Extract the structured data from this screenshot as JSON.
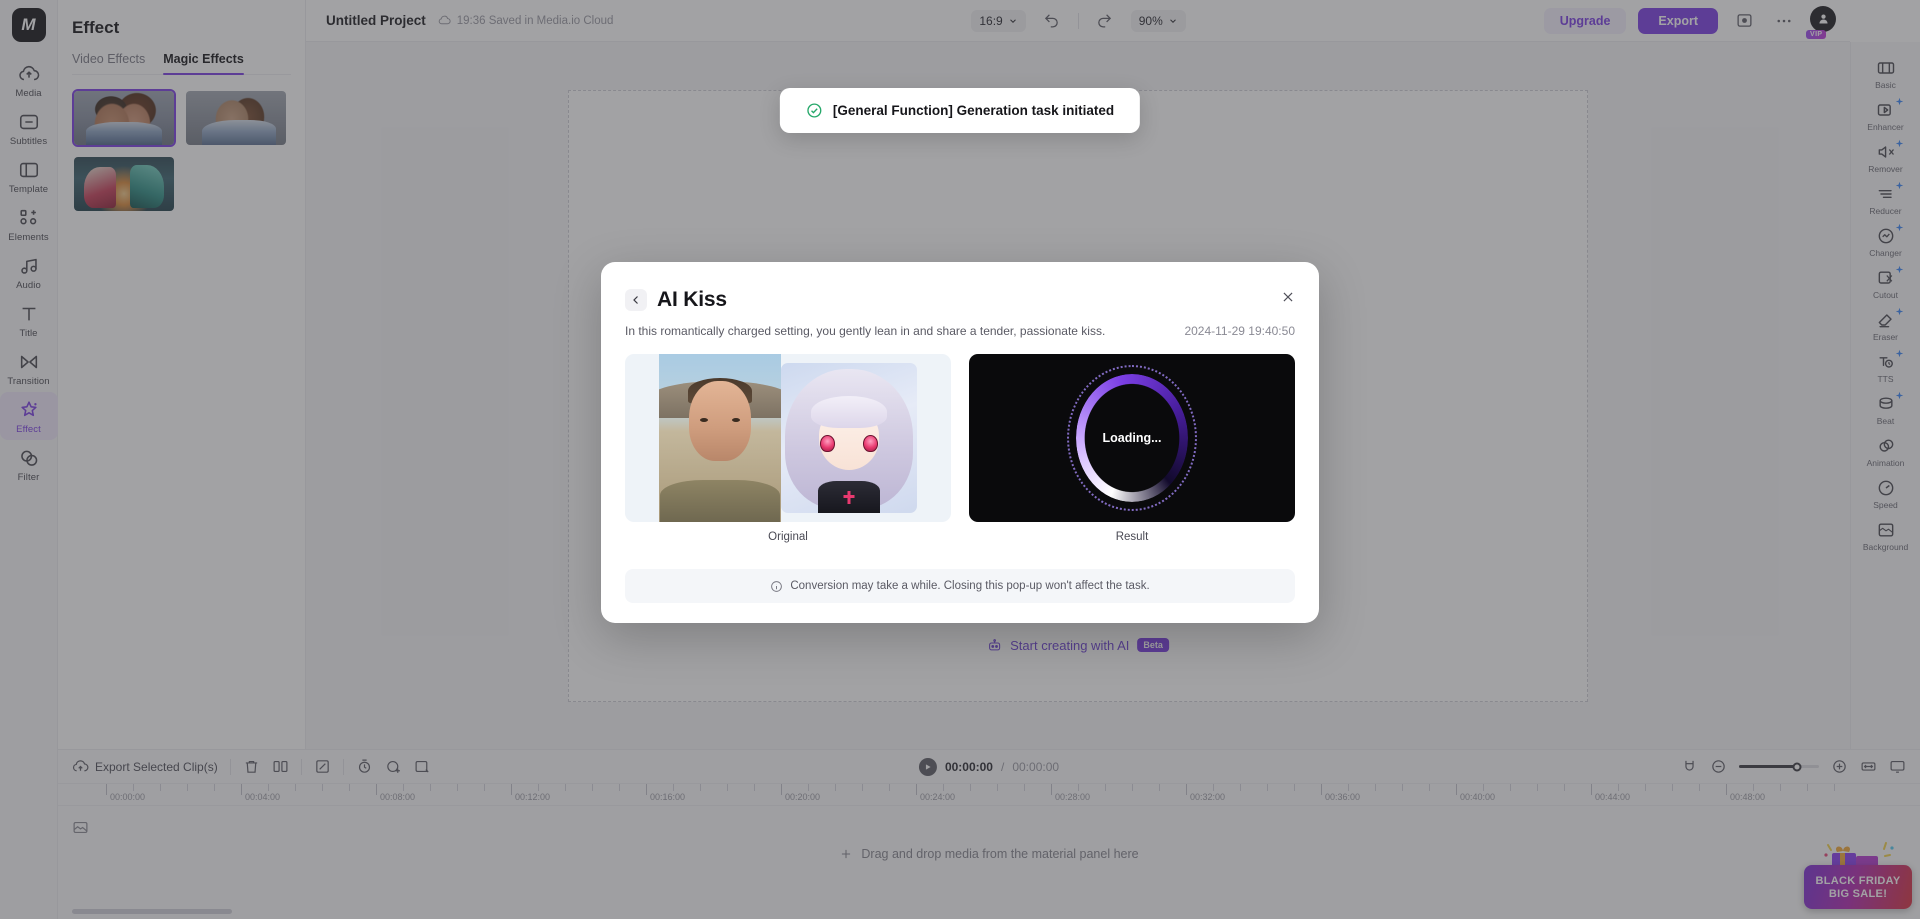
{
  "app": {
    "logo_text": "M"
  },
  "left_rail": {
    "items": [
      {
        "label": "Media",
        "icon": "cloud-upload-icon",
        "active": false
      },
      {
        "label": "Subtitles",
        "icon": "subtitles-icon",
        "active": false
      },
      {
        "label": "Template",
        "icon": "template-icon",
        "active": false
      },
      {
        "label": "Elements",
        "icon": "elements-icon",
        "active": false
      },
      {
        "label": "Audio",
        "icon": "music-note-icon",
        "active": false
      },
      {
        "label": "Title",
        "icon": "text-title-icon",
        "active": false
      },
      {
        "label": "Transition",
        "icon": "transition-icon",
        "active": false
      },
      {
        "label": "Effect",
        "icon": "magic-star-icon",
        "active": true
      },
      {
        "label": "Filter",
        "icon": "filter-icon",
        "active": false
      }
    ]
  },
  "panel": {
    "title": "Effect",
    "tabs": [
      {
        "label": "Video Effects",
        "active": false
      },
      {
        "label": "Magic Effects",
        "active": true
      }
    ],
    "thumbnails": [
      {
        "name": "ai-kiss-effect",
        "art": "art-kiss1",
        "selected": true
      },
      {
        "name": "ai-hug-effect",
        "art": "art-hug",
        "selected": false
      },
      {
        "name": "ai-superhero-effect",
        "art": "art-hero",
        "selected": false
      }
    ]
  },
  "topbar": {
    "project_name": "Untitled Project",
    "saved_status": "19:36 Saved in Media.io Cloud",
    "aspect_ratio": "16:9",
    "zoom_level": "90%",
    "upgrade_label": "Upgrade",
    "export_label": "Export",
    "vip_badge": "VIP"
  },
  "stage": {
    "ai_cta_label": "Start creating with AI",
    "ai_cta_badge": "Beta"
  },
  "right_rail": {
    "items": [
      {
        "label": "Basic",
        "icon": "basic-icon",
        "pro": false
      },
      {
        "label": "Enhancer",
        "icon": "enhancer-icon",
        "pro": true
      },
      {
        "label": "Remover",
        "icon": "remover-icon",
        "pro": true
      },
      {
        "label": "Reducer",
        "icon": "reducer-icon",
        "pro": true
      },
      {
        "label": "Changer",
        "icon": "changer-icon",
        "pro": true
      },
      {
        "label": "Cutout",
        "icon": "cutout-icon",
        "pro": true
      },
      {
        "label": "Eraser",
        "icon": "eraser-icon",
        "pro": true
      },
      {
        "label": "TTS",
        "icon": "tts-icon",
        "pro": true
      },
      {
        "label": "Beat",
        "icon": "beat-icon",
        "pro": true
      },
      {
        "label": "Animation",
        "icon": "animation-icon",
        "pro": false
      },
      {
        "label": "Speed",
        "icon": "speed-icon",
        "pro": false
      },
      {
        "label": "Background",
        "icon": "background-icon",
        "pro": false
      }
    ]
  },
  "timeline": {
    "export_clips_label": "Export Selected Clip(s)",
    "current_time": "00:00:00",
    "total_time": "00:00:00",
    "time_separator": "/",
    "drop_hint": "Drag and drop media from the material panel here",
    "ruler_labels": [
      "00:00:00",
      "00:04:00",
      "00:08:00",
      "00:12:00",
      "00:16:00",
      "00:20:00",
      "00:24:00",
      "00:28:00",
      "00:32:00",
      "00:36:00",
      "00:40:00",
      "00:44:00",
      "00:48:00"
    ],
    "zoom_slider_percent": 72
  },
  "toast": {
    "message": "[General Function] Generation task initiated",
    "icon": "check-circle-icon"
  },
  "modal": {
    "title": "AI Kiss",
    "description": "In this romantically charged setting, you gently lean in and share a tender, passionate kiss.",
    "timestamp": "2024-11-29 19:40:50",
    "original_caption": "Original",
    "result_caption": "Result",
    "loading_text": "Loading...",
    "note": "Conversion may take a while. Closing this pop-up won't affect the task."
  },
  "promo": {
    "line1": "BLACK FRIDAY",
    "line2": "BIG SALE!"
  },
  "colors": {
    "accent": "#7b3fe4",
    "accent_soft": "#f3effd",
    "toast_success": "#26a86a",
    "pro_blue": "#3b87f7"
  }
}
